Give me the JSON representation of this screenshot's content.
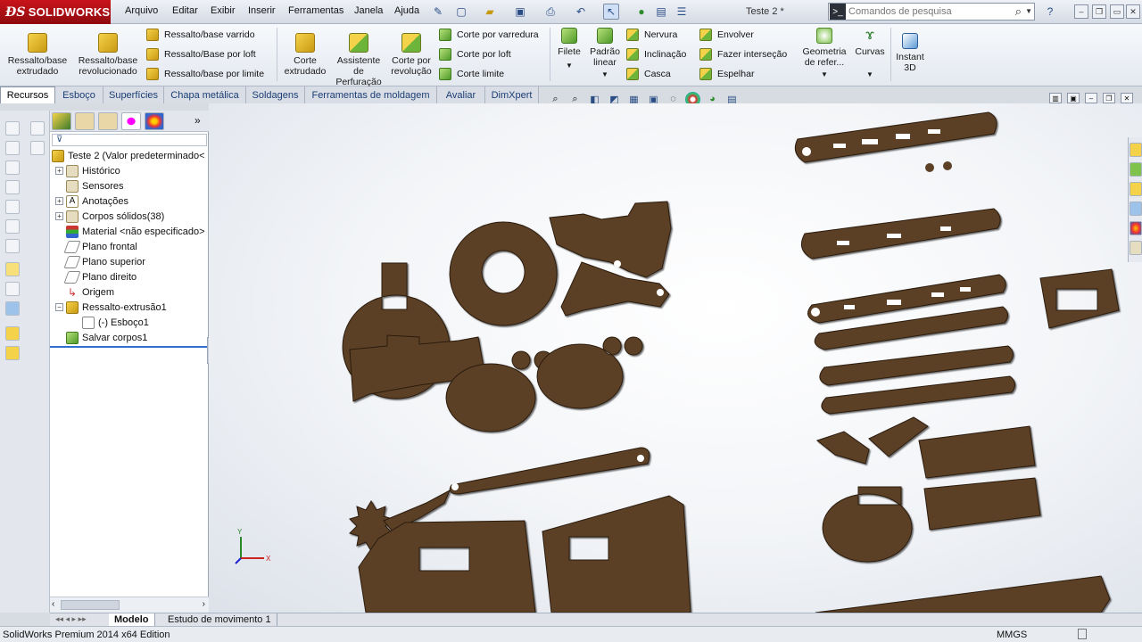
{
  "app": {
    "logo": "SOLIDWORKS",
    "document_title": "Teste 2 *"
  },
  "menu": [
    "Arquivo",
    "Editar",
    "Exibir",
    "Inserir",
    "Ferramentas",
    "Janela",
    "Ajuda"
  ],
  "search": {
    "placeholder": "Comandos de pesquisa"
  },
  "ribbon": {
    "large": [
      {
        "label": "Ressalto/base extrudado"
      },
      {
        "label": "Ressalto/base revolucionado"
      },
      {
        "label": "Corte extrudado"
      },
      {
        "label": "Assistente de Perfuração"
      },
      {
        "label": "Corte por revolução"
      },
      {
        "label": "Filete"
      },
      {
        "label": "Padrão linear"
      },
      {
        "label": "Geometria de refer..."
      },
      {
        "label": "Curvas"
      },
      {
        "label": "Instant 3D"
      }
    ],
    "small": [
      {
        "label": "Ressalto/base varrido"
      },
      {
        "label": "Ressalto/Base por loft"
      },
      {
        "label": "Ressalto/base por limite"
      },
      {
        "label": "Corte por varredura"
      },
      {
        "label": "Corte por loft"
      },
      {
        "label": "Corte limite"
      },
      {
        "label": "Nervura"
      },
      {
        "label": "Inclinação"
      },
      {
        "label": "Casca"
      },
      {
        "label": "Envolver"
      },
      {
        "label": "Fazer interseção"
      },
      {
        "label": "Espelhar"
      }
    ]
  },
  "tabs": [
    "Recursos",
    "Esboço",
    "Superfícies",
    "Chapa metálica",
    "Soldagens",
    "Ferramentas de moldagem",
    "Avaliar",
    "DimXpert"
  ],
  "feature_tree": {
    "filter_icon": "funnel-icon",
    "root": "Teste 2  (Valor predeterminado<",
    "items": [
      {
        "label": "Histórico",
        "expandable": true
      },
      {
        "label": "Sensores",
        "expandable": false
      },
      {
        "label": "Anotações",
        "expandable": true
      },
      {
        "label": "Corpos sólidos(38)",
        "expandable": true
      },
      {
        "label": "Material <não especificado>",
        "expandable": false
      },
      {
        "label": "Plano frontal",
        "expandable": false
      },
      {
        "label": "Plano superior",
        "expandable": false
      },
      {
        "label": "Plano direito",
        "expandable": false
      },
      {
        "label": "Origem",
        "expandable": false
      },
      {
        "label": "Ressalto-extrusão1",
        "expandable": true
      },
      {
        "label": "(-) Esboço1",
        "expandable": false
      },
      {
        "label": "Salvar corpos1",
        "expandable": false
      }
    ]
  },
  "triad": {
    "x": "X",
    "y": "Y"
  },
  "bottom_tabs": [
    "Modelo",
    "Estudo de movimento 1"
  ],
  "status": {
    "edition": "SolidWorks Premium 2014 x64 Edition",
    "units": "MMGS"
  },
  "colors": {
    "part": "#5c4127",
    "part_edge": "#2a1a0c",
    "accent": "#c8141a"
  }
}
